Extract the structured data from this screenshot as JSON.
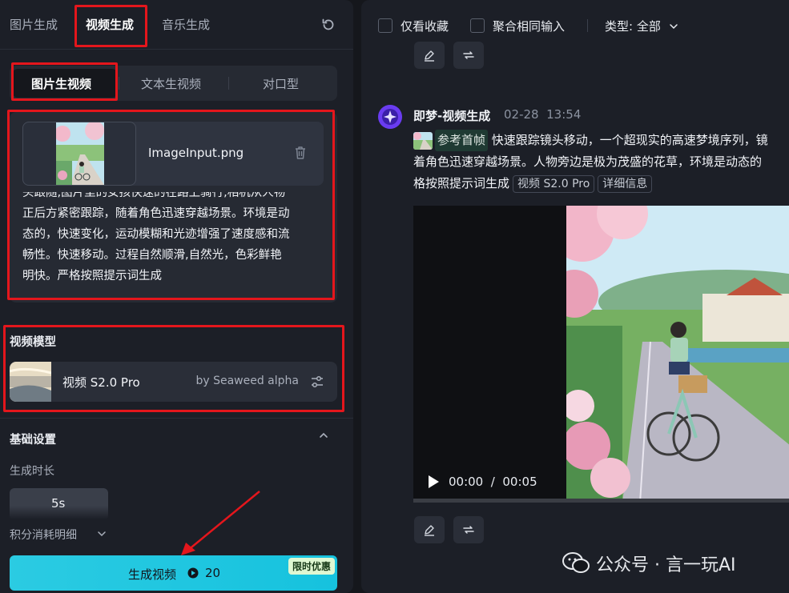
{
  "left": {
    "tabs": [
      "图片生成",
      "视频生成",
      "音乐生成"
    ],
    "active_tab": "视频生成",
    "subtabs": [
      "图片生视频",
      "文本生视频",
      "对口型"
    ],
    "upload": {
      "filename": "ImageInput.png",
      "prompt_lines": [
        "头跟随,图片里的女孩快速的在路上骑行,相机从人物",
        "正后方紧密跟踪，随着角色迅速穿越场景。环境是动",
        "态的，快速变化，运动模糊和光迹增强了速度感和流",
        "畅性。快速移动。过程自然顺滑,自然光，色彩鲜艳",
        "明快。严格按照提示词生成"
      ]
    },
    "model_section_title": "视频模型",
    "model": {
      "name": "视频 S2.0 Pro",
      "by": "by Seaweed alpha"
    },
    "basic_settings": "基础设置",
    "duration_label": "生成时长",
    "duration_value": "5s",
    "points_detail": "积分消耗明细",
    "generate": {
      "label": "生成视频",
      "cost": "20",
      "promo": "限时优惠"
    }
  },
  "right": {
    "filters": {
      "favorites_only": "仅看收藏",
      "merge_same_input": "聚合相同输入",
      "type_label": "类型: 全部"
    },
    "message": {
      "author": "即梦-视频生成",
      "date": "02-28",
      "time": "13:54",
      "ref_label": "参考首帧",
      "text_line1": "快速跟踪镜头移动，一个超现实的高速梦境序列，镜",
      "text_line2": "着角色迅速穿越场景。人物旁边是极为茂盛的花草，环境是动态的",
      "text_line3": "格按照提示词生成",
      "tag_model": "视频 S2.0 Pro",
      "tag_detail": "详细信息"
    },
    "video": {
      "current": "00:00",
      "separator": "/",
      "duration": "00:05"
    },
    "watermark": "公众号 · 言一玩AI"
  },
  "colors": {
    "accent": "#26c6da",
    "annotation_red": "#e4161c",
    "panel_bg": "#1c1f27"
  }
}
